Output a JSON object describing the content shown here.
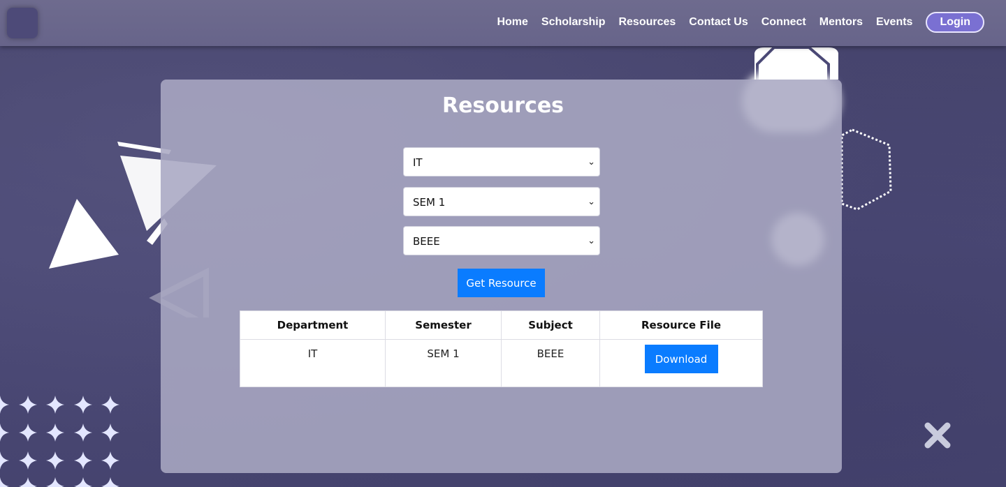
{
  "nav": {
    "links": [
      "Home",
      "Scholarship",
      "Resources",
      "Contact Us",
      "Connect",
      "Mentors",
      "Events"
    ],
    "login_label": "Login"
  },
  "card": {
    "title": "Resources",
    "filters": {
      "department": "IT",
      "semester": "SEM 1",
      "subject": "BEEE"
    },
    "get_button": "Get Resource",
    "table": {
      "headers": [
        "Department",
        "Semester",
        "Subject",
        "Resource File"
      ],
      "rows": [
        {
          "department": "IT",
          "semester": "SEM 1",
          "subject": "BEEE",
          "action": "Download"
        }
      ]
    }
  },
  "colors": {
    "background": "#4a4870",
    "navbar": "#6e6b8e",
    "card": "#aaa8c3",
    "primary_button": "#0a7cff",
    "login_button": "#7a70d2"
  },
  "icons": {
    "select_arrow": "chevron-down-icon",
    "decor": [
      "triangle-icon",
      "hexagon-icon",
      "sparkle-icon",
      "x-icon"
    ]
  }
}
